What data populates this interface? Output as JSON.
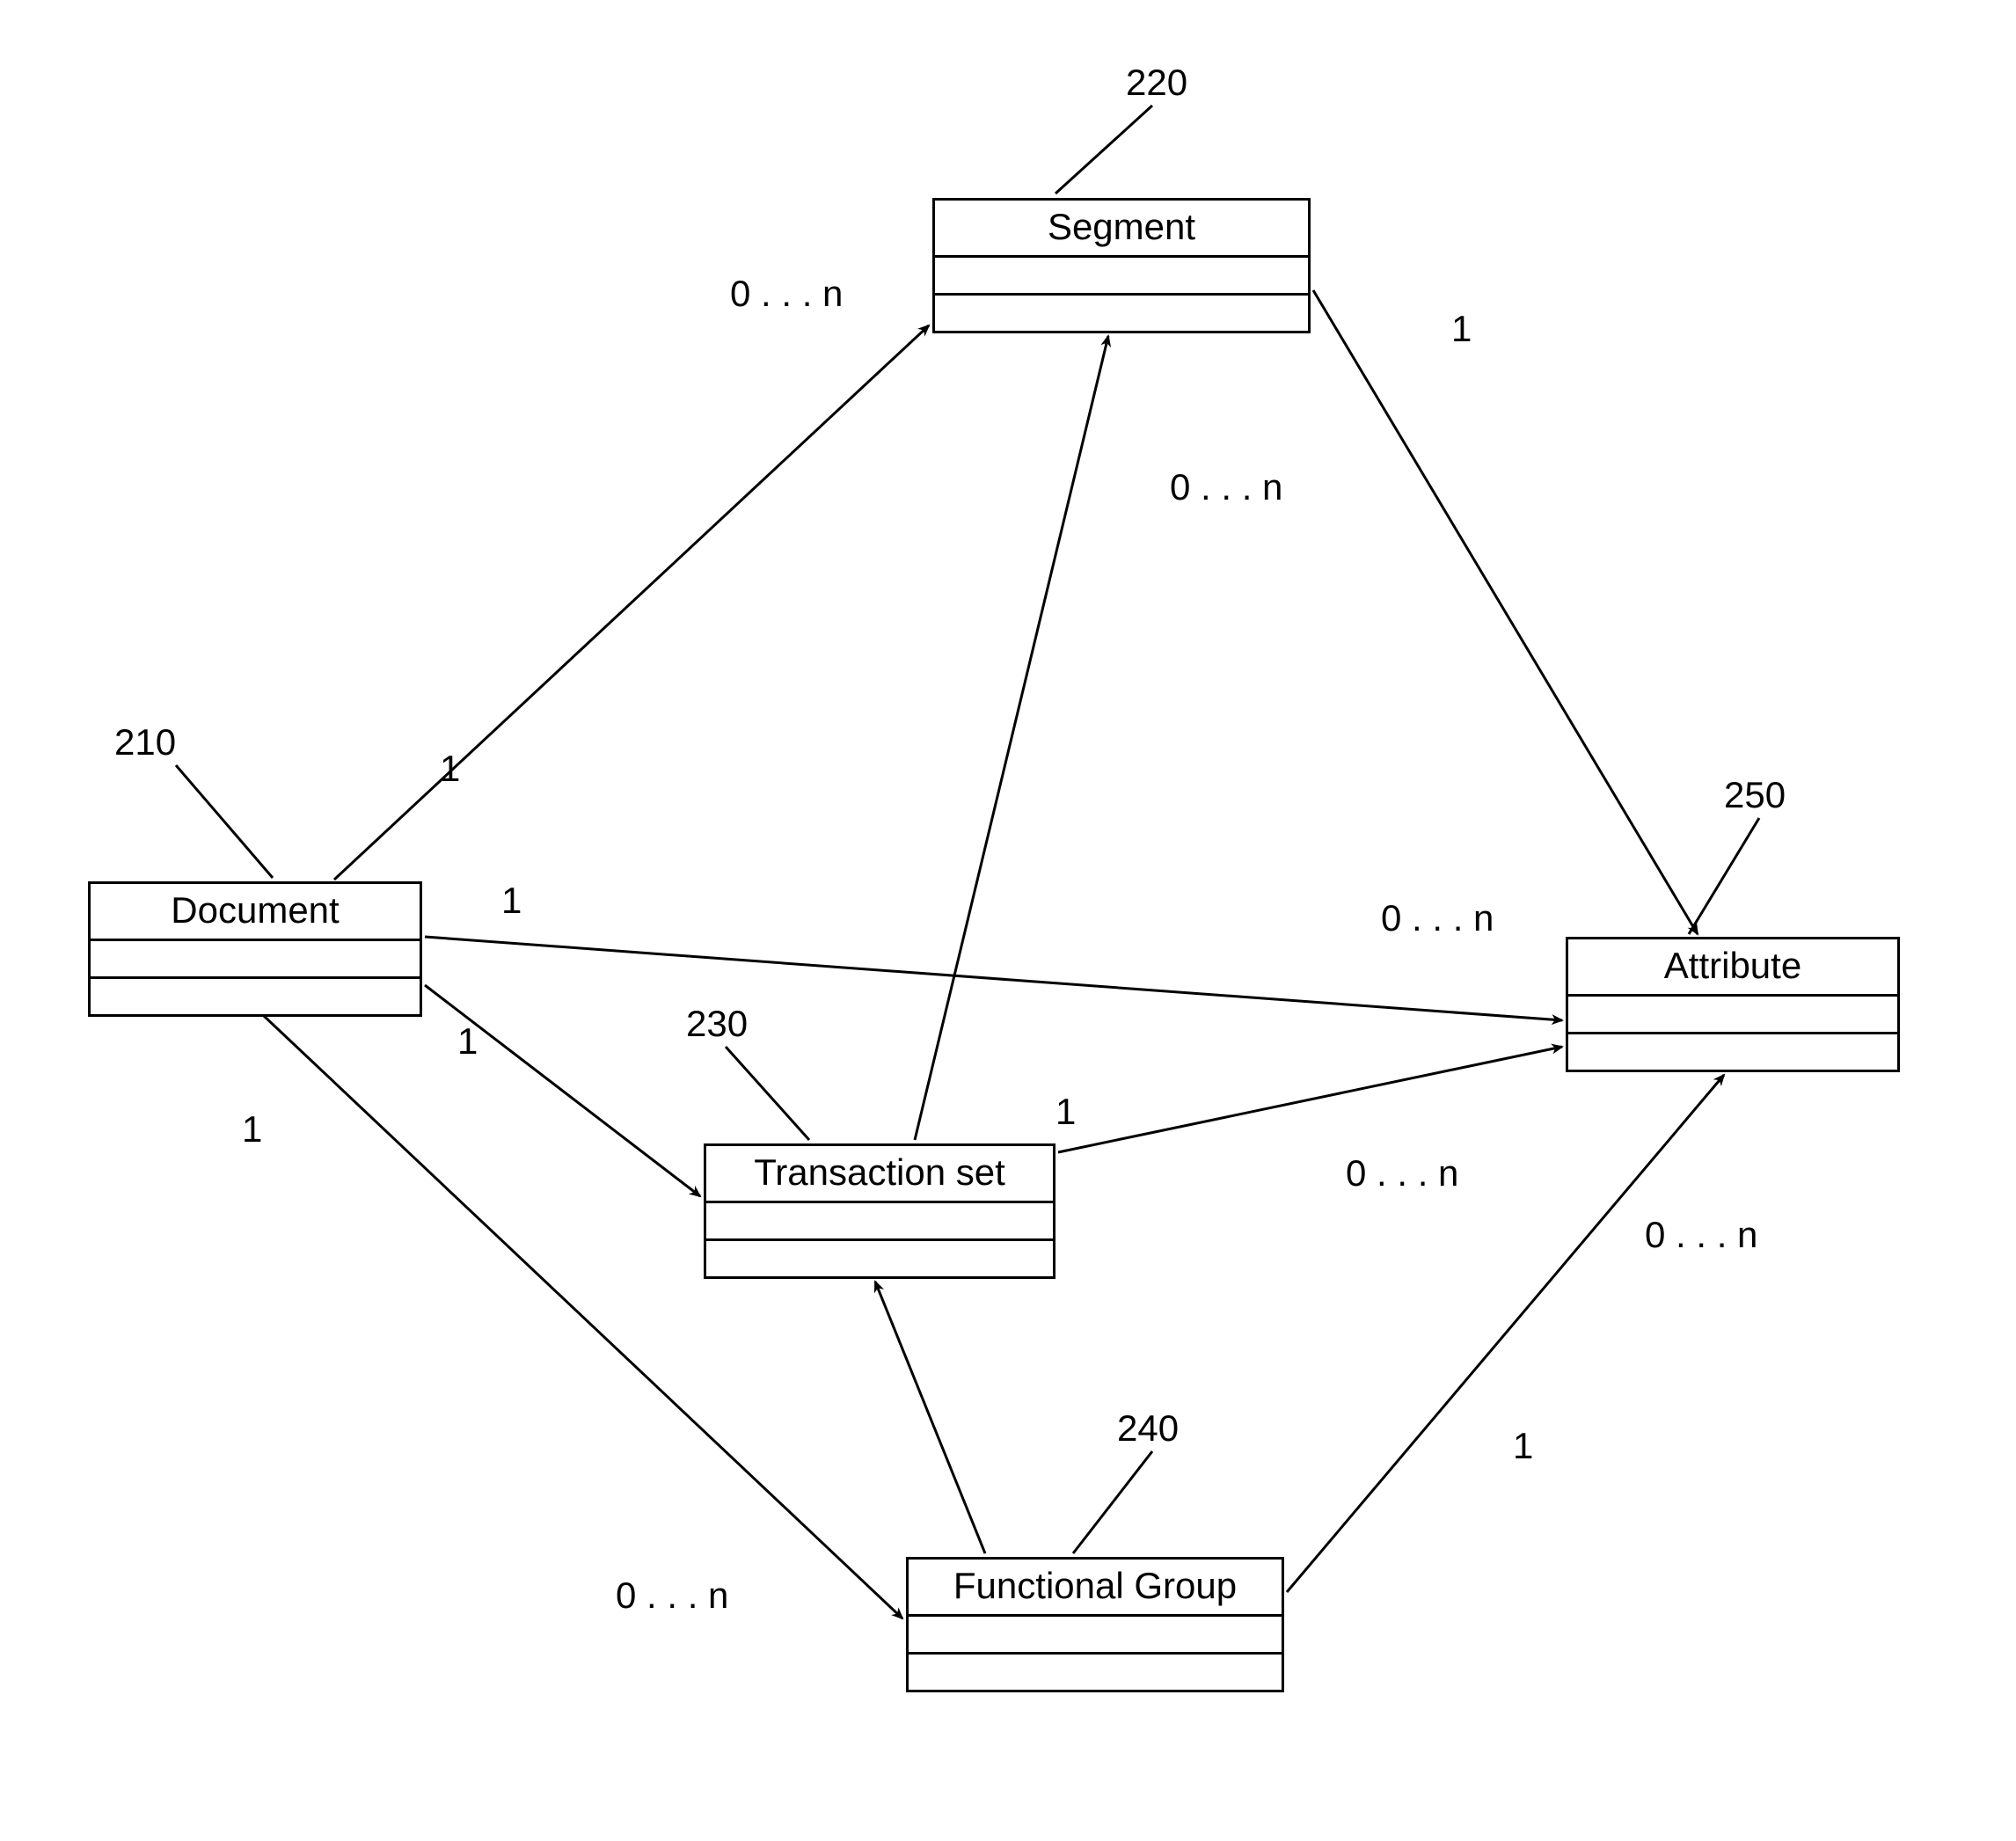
{
  "diagram": {
    "entities": {
      "document": {
        "label": "Document",
        "ref": "210"
      },
      "segment": {
        "label": "Segment",
        "ref": "220"
      },
      "transaction_set": {
        "label": "Transaction set",
        "ref": "230"
      },
      "functional_group": {
        "label": "Functional Group",
        "ref": "240"
      },
      "attribute": {
        "label": "Attribute",
        "ref": "250"
      }
    },
    "relations": {
      "doc_to_segment": {
        "src": "1",
        "dst": "0 . . . n"
      },
      "doc_to_attribute": {
        "src": "1",
        "dst": "0 . . . n"
      },
      "doc_to_txn": {
        "src": "1"
      },
      "doc_to_fg": {
        "src": "1",
        "dst": "0 . . . n"
      },
      "segment_to_attribute": {
        "src": "1"
      },
      "txn_to_segment": {
        "dst": "0 . . . n"
      },
      "txn_to_attribute": {
        "src": "1",
        "dst": "0 . . . n"
      },
      "fg_to_attribute": {
        "src": "1",
        "dst": "0 . . . n"
      },
      "fg_to_txn": {}
    }
  }
}
